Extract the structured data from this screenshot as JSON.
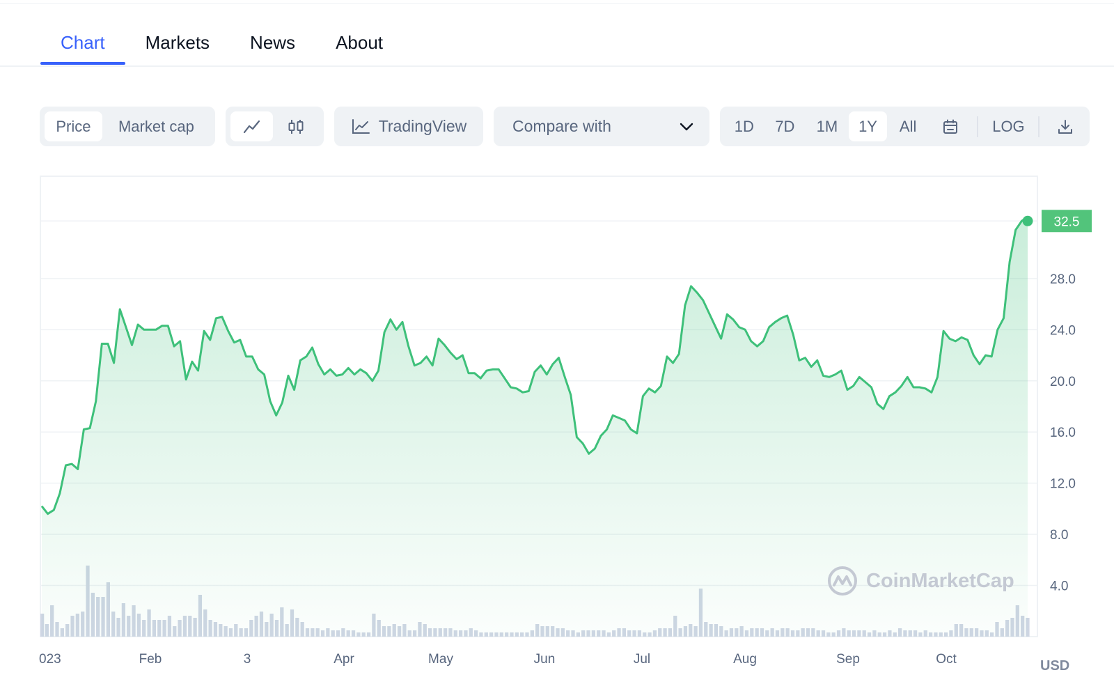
{
  "tabs": [
    "Chart",
    "Markets",
    "News",
    "About"
  ],
  "controls": {
    "price_label": "Price",
    "market_cap_label": "Market cap",
    "line_icon": "line-chart-icon",
    "candle_icon": "candlestick-icon",
    "tradingview_label": "TradingView",
    "compare_label": "Compare with",
    "ranges": [
      "1D",
      "7D",
      "1M",
      "1Y",
      "All"
    ],
    "active_range": "1Y",
    "log_label": "LOG"
  },
  "watermark": "CoinMarketCap",
  "currency": "USD",
  "colors": {
    "accent": "#3861fb",
    "up": "#16c784",
    "line": "#3ec07a",
    "price_tag": "#52c47b",
    "volume": "#cfd6e4"
  },
  "chart_data": {
    "type": "area",
    "x_ticks": [
      "023",
      "Feb",
      "3",
      "Apr",
      "May",
      "Jun",
      "Jul",
      "Aug",
      "Sep",
      "Oct"
    ],
    "y_ticks": [
      "4.0",
      "8.0",
      "12.0",
      "16.0",
      "20.0",
      "24.0",
      "28.0",
      "32.5"
    ],
    "ylim": [
      0,
      36
    ],
    "last_price": "32.5",
    "price": [
      10.2,
      9.6,
      9.9,
      11.2,
      13.4,
      13.5,
      13.1,
      16.2,
      16.3,
      18.4,
      22.9,
      22.9,
      21.4,
      25.6,
      24.2,
      22.8,
      24.4,
      24.0,
      24.0,
      24.0,
      24.3,
      24.3,
      22.7,
      23.1,
      20.1,
      21.5,
      20.8,
      23.9,
      23.2,
      24.9,
      25.0,
      23.9,
      23.0,
      23.2,
      21.9,
      21.9,
      20.9,
      20.5,
      18.4,
      17.3,
      18.3,
      20.4,
      19.3,
      21.6,
      21.9,
      22.6,
      21.3,
      20.5,
      20.9,
      20.4,
      20.5,
      21.0,
      20.5,
      20.9,
      20.6,
      20.0,
      20.8,
      23.8,
      24.8,
      24.0,
      24.6,
      22.7,
      21.2,
      21.4,
      21.9,
      21.2,
      23.3,
      22.8,
      22.2,
      21.7,
      22.0,
      20.6,
      20.6,
      20.2,
      20.8,
      20.9,
      20.9,
      20.2,
      19.5,
      19.4,
      19.1,
      19.2,
      20.7,
      21.2,
      20.5,
      21.3,
      21.8,
      20.3,
      18.9,
      15.6,
      15.1,
      14.3,
      14.7,
      15.7,
      16.2,
      17.3,
      17.1,
      16.9,
      16.2,
      15.9,
      18.8,
      19.4,
      19.1,
      19.6,
      21.9,
      21.4,
      22.1,
      25.9,
      27.4,
      26.9,
      26.3,
      25.3,
      24.3,
      23.3,
      25.2,
      24.8,
      24.2,
      24.0,
      23.1,
      22.7,
      23.1,
      24.2,
      24.6,
      24.9,
      25.1,
      23.6,
      21.6,
      21.8,
      21.1,
      21.6,
      20.4,
      20.3,
      20.5,
      20.8,
      19.3,
      19.6,
      20.3,
      19.9,
      19.5,
      18.2,
      17.8,
      18.8,
      19.1,
      19.6,
      20.3,
      19.5,
      19.5,
      19.4,
      19.1,
      20.3,
      23.9,
      23.3,
      23.1,
      23.4,
      23.2,
      22.0,
      21.3,
      22.0,
      21.9,
      24.0,
      24.9,
      29.3,
      31.8,
      32.5,
      32.8
    ],
    "volume": [
      1.1,
      0.6,
      1.5,
      0.7,
      0.4,
      0.6,
      1.0,
      1.1,
      1.2,
      3.4,
      2.1,
      1.9,
      1.9,
      2.6,
      1.2,
      0.9,
      1.6,
      1.0,
      1.5,
      1.1,
      0.8,
      1.3,
      0.8,
      0.8,
      0.8,
      1.0,
      0.5,
      0.8,
      1.0,
      1.0,
      0.9,
      2.0,
      1.3,
      0.8,
      0.7,
      0.6,
      0.5,
      0.4,
      0.6,
      0.4,
      0.4,
      0.8,
      1.0,
      1.2,
      0.7,
      1.1,
      0.8,
      1.4,
      0.6,
      1.3,
      0.9,
      0.7,
      0.4,
      0.4,
      0.4,
      0.3,
      0.4,
      0.3,
      0.3,
      0.4,
      0.3,
      0.3,
      0.2,
      0.2,
      0.2,
      1.1,
      0.8,
      0.5,
      0.5,
      0.6,
      0.5,
      0.6,
      0.3,
      0.3,
      0.7,
      0.6,
      0.4,
      0.4,
      0.4,
      0.4,
      0.4,
      0.3,
      0.3,
      0.3,
      0.4,
      0.3,
      0.2,
      0.2,
      0.2,
      0.2,
      0.2,
      0.2,
      0.2,
      0.2,
      0.2,
      0.2,
      0.3,
      0.6,
      0.5,
      0.5,
      0.5,
      0.4,
      0.4,
      0.3,
      0.3,
      0.2,
      0.3,
      0.3,
      0.3,
      0.3,
      0.3,
      0.2,
      0.3,
      0.4,
      0.4,
      0.3,
      0.3,
      0.3,
      0.2,
      0.2,
      0.3,
      0.4,
      0.4,
      0.4,
      1.0,
      0.4,
      0.5,
      0.6,
      0.5,
      2.3,
      0.7,
      0.6,
      0.6,
      0.5,
      0.3,
      0.4,
      0.4,
      0.5,
      0.3,
      0.4,
      0.4,
      0.4,
      0.3,
      0.4,
      0.3,
      0.4,
      0.4,
      0.3,
      0.3,
      0.4,
      0.4,
      0.4,
      0.3,
      0.3,
      0.2,
      0.2,
      0.3,
      0.4,
      0.3,
      0.3,
      0.3,
      0.3,
      0.2,
      0.3,
      0.2,
      0.2,
      0.3,
      0.2,
      0.4,
      0.3,
      0.3,
      0.3,
      0.2,
      0.3,
      0.2,
      0.2,
      0.2,
      0.2,
      0.3,
      0.6,
      0.6,
      0.4,
      0.4,
      0.4,
      0.3,
      0.3,
      0.2,
      0.7,
      0.4,
      0.8,
      0.9,
      1.5,
      1.0,
      0.9
    ]
  }
}
